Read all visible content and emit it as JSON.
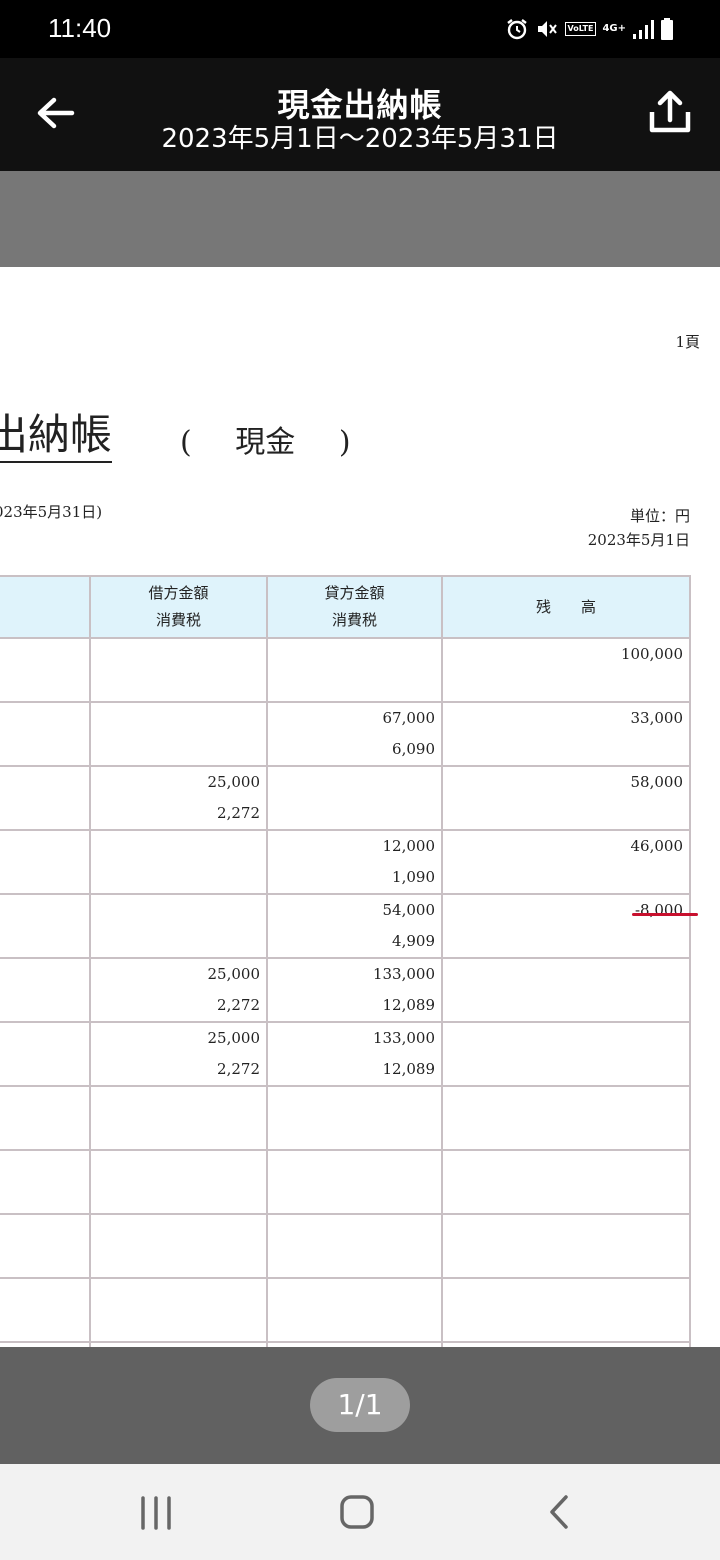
{
  "status_bar": {
    "time": "11:40",
    "icons": [
      "alarm-icon",
      "mute-icon",
      "volte-icon",
      "4g-icon",
      "signal-icon",
      "battery-icon"
    ],
    "volte_text": "VoLTE",
    "network_text": "4G+"
  },
  "header": {
    "title": "現金出納帳",
    "subtitle": "2023年5月1日〜2023年5月31日",
    "back_icon": "arrow-left-icon",
    "share_icon": "share-icon"
  },
  "document": {
    "page_no": "1頁",
    "title_partial": "出納帳",
    "account_open": "(",
    "account_name": "現金",
    "account_close": ")",
    "period_partial": "023年5月31日)",
    "unit": "単位：円",
    "date": "2023年5月1日",
    "columns": {
      "debit_label": "借方金額",
      "debit_tax_label": "消費税",
      "credit_label": "貸方金額",
      "credit_tax_label": "消費税",
      "balance_label": "残　　高"
    },
    "rows": [
      {
        "debit": "",
        "debit_tax": "",
        "credit": "",
        "credit_tax": "",
        "balance": "100,000"
      },
      {
        "debit": "",
        "debit_tax": "",
        "credit": "67,000",
        "credit_tax": "6,090",
        "balance": "33,000"
      },
      {
        "debit": "25,000",
        "debit_tax": "2,272",
        "credit": "",
        "credit_tax": "",
        "balance": "58,000"
      },
      {
        "debit": "",
        "debit_tax": "",
        "credit": "12,000",
        "credit_tax": "1,090",
        "balance": "46,000"
      },
      {
        "debit": "",
        "debit_tax": "",
        "credit": "54,000",
        "credit_tax": "4,909",
        "balance": "-8,000"
      },
      {
        "debit": "25,000",
        "debit_tax": "2,272",
        "credit": "133,000",
        "credit_tax": "12,089",
        "balance": ""
      },
      {
        "debit": "25,000",
        "debit_tax": "2,272",
        "credit": "133,000",
        "credit_tax": "12,089",
        "balance": ""
      },
      {
        "debit": "",
        "debit_tax": "",
        "credit": "",
        "credit_tax": "",
        "balance": ""
      },
      {
        "debit": "",
        "debit_tax": "",
        "credit": "",
        "credit_tax": "",
        "balance": ""
      },
      {
        "debit": "",
        "debit_tax": "",
        "credit": "",
        "credit_tax": "",
        "balance": ""
      },
      {
        "debit": "",
        "debit_tax": "",
        "credit": "",
        "credit_tax": "",
        "balance": ""
      },
      {
        "debit": "",
        "debit_tax": "",
        "credit": "",
        "credit_tax": "",
        "balance": ""
      }
    ],
    "highlight_color": "#c8102e"
  },
  "pager": {
    "label": "1/1"
  },
  "nav": {
    "recents_icon": "recents-icon",
    "home_icon": "home-icon",
    "back_icon": "nav-back-icon"
  }
}
